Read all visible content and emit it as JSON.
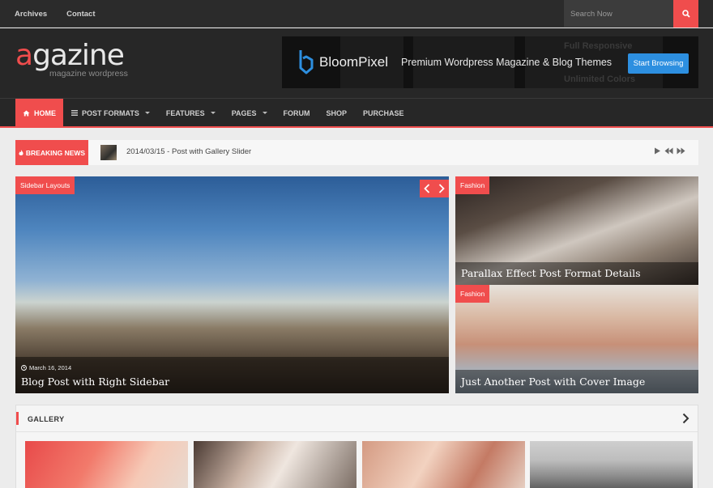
{
  "topbar": {
    "links": [
      "Archives",
      "Contact"
    ],
    "search_placeholder": "Search Now",
    "search_icon": "search-icon"
  },
  "header": {
    "logo_accent": "a",
    "logo_rest": "gazine",
    "logo_tagline": "magazine wordpress",
    "banner": {
      "brand": "BloomPixel",
      "tagline": "Premium Wordpress Magazine & Blog Themes",
      "cta": "Start Browsing",
      "faint_lines": [
        "Full Responsive",
        "Unlimited Colors"
      ]
    }
  },
  "nav": {
    "items": [
      {
        "label": "HOME",
        "icon": "home-icon",
        "active": true
      },
      {
        "label": "POST FORMATS",
        "icon": "menu-icon",
        "dropdown": true
      },
      {
        "label": "FEATURES",
        "dropdown": true
      },
      {
        "label": "PAGES",
        "dropdown": true
      },
      {
        "label": "FORUM"
      },
      {
        "label": "SHOP"
      },
      {
        "label": "PURCHASE"
      }
    ]
  },
  "breaking": {
    "label": "BREAKING NEWS",
    "date": "2014/03/15",
    "headline": " - Post with Gallery Slider"
  },
  "featured": {
    "main": {
      "category": "Sidebar Layouts",
      "date": "March 16, 2014",
      "title": "Blog Post with Right Sidebar"
    },
    "side": [
      {
        "category": "Fashion",
        "title": "Parallax Effect Post Format Details"
      },
      {
        "category": "Fashion",
        "title": "Just Another Post with Cover Image"
      }
    ]
  },
  "gallery": {
    "title": "GALLERY"
  },
  "colors": {
    "accent": "#f04d4d",
    "dark": "#272727",
    "cta_blue": "#2d8fe0"
  }
}
